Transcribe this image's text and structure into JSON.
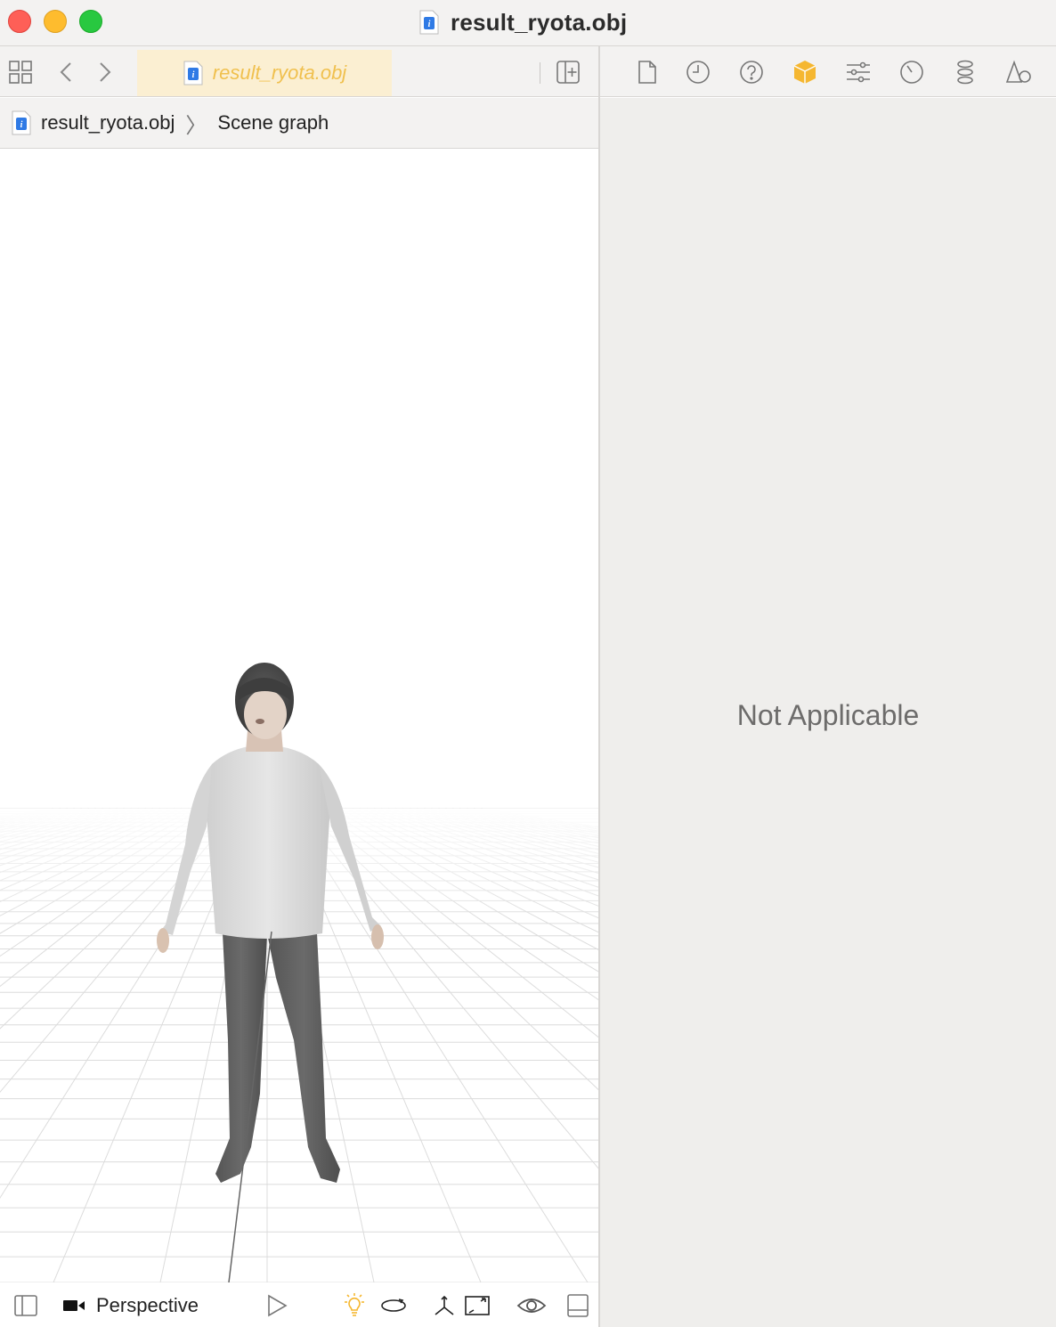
{
  "window": {
    "title": "result_ryota.obj",
    "buttons": {
      "close": "close-button",
      "minimize": "minimize-button",
      "zoom": "zoom-button"
    },
    "colors": {
      "close": "#fe5f57",
      "minimize": "#febc2e",
      "zoom": "#28c840"
    }
  },
  "toolbar": {
    "tab_label": "result_ryota.obj",
    "icons": [
      "grid-icon",
      "chevron-left-icon",
      "chevron-right-icon",
      "add-editor-icon"
    ],
    "tab_color": "#fbefd2",
    "tab_text_color": "#f0c04e"
  },
  "breadcrumb": {
    "items": [
      "result_ryota.obj",
      "Scene graph"
    ],
    "separator": "〉"
  },
  "inspector": {
    "icons": [
      "file-icon",
      "history-icon",
      "help-icon",
      "cube-icon",
      "sliders-icon",
      "gauge-icon",
      "physics-icon",
      "shapes-icon"
    ],
    "selected_icon": "cube-icon",
    "accent": "#f5b731",
    "message": "Not Applicable"
  },
  "bottom_bar": {
    "camera_label": "Perspective",
    "icons": [
      "sidebar-icon",
      "camera-icon",
      "play-icon",
      "light-icon",
      "orbit-icon",
      "axes-icon",
      "frame-icon",
      "eye-icon",
      "panel-icon"
    ]
  }
}
